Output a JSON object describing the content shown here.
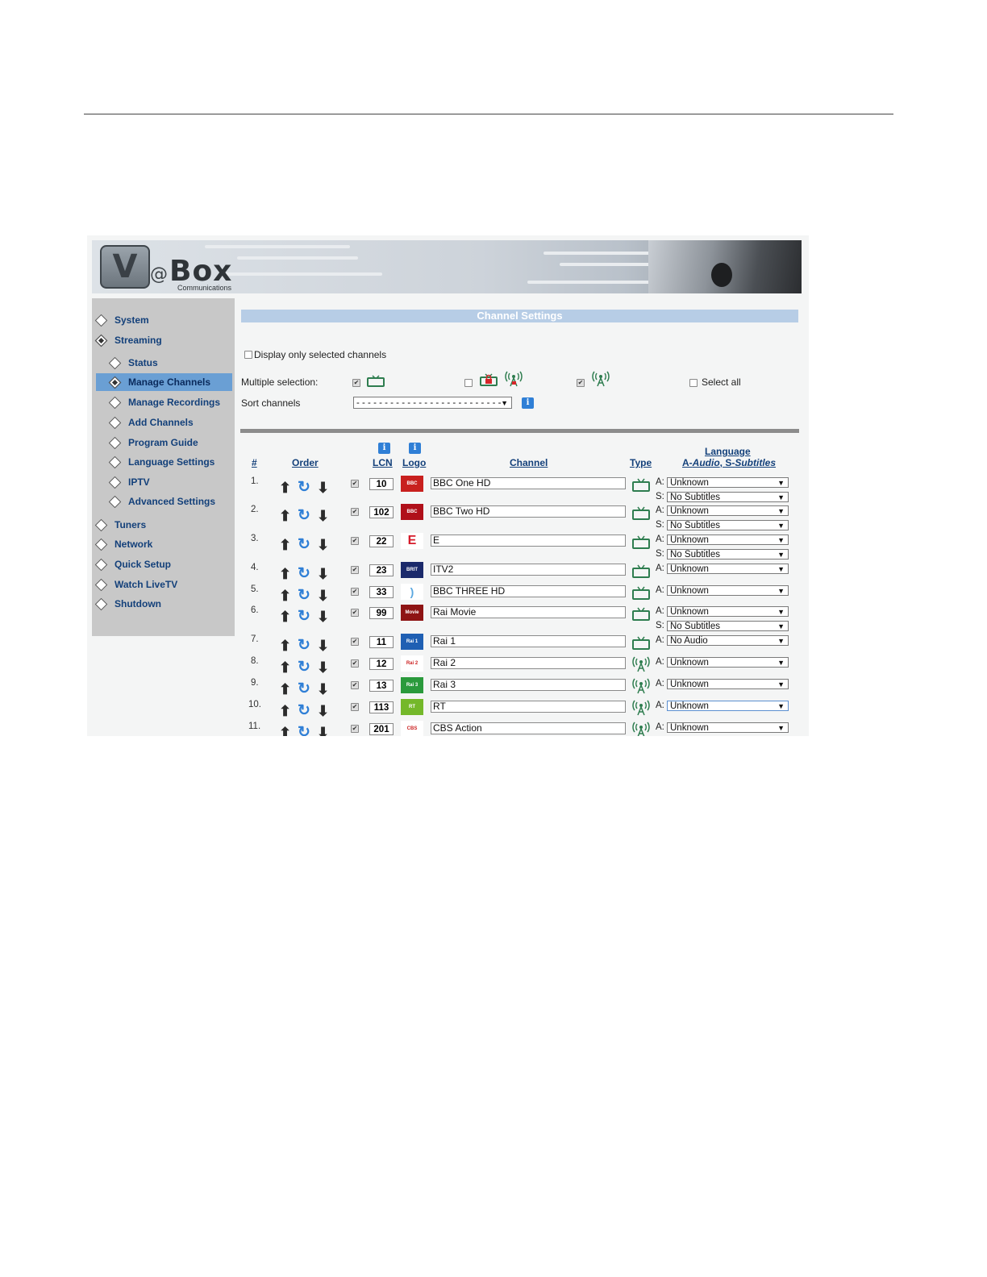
{
  "banner": {
    "logo_letter": "V",
    "logo_at": "@",
    "logo_text": "Box",
    "logo_sub": "Communications"
  },
  "sidebar": {
    "items": [
      {
        "label": "System",
        "indent": false,
        "filled": false,
        "active": false
      },
      {
        "label": "Streaming",
        "indent": false,
        "filled": true,
        "active": false
      },
      {
        "label": "Status",
        "indent": true,
        "filled": false,
        "active": false
      },
      {
        "label": "Manage Channels",
        "indent": true,
        "filled": true,
        "active": true
      },
      {
        "label": "Manage Recordings",
        "indent": true,
        "filled": false,
        "active": false
      },
      {
        "label": "Add Channels",
        "indent": true,
        "filled": false,
        "active": false
      },
      {
        "label": "Program Guide",
        "indent": true,
        "filled": false,
        "active": false
      },
      {
        "label": "Language Settings",
        "indent": true,
        "filled": false,
        "active": false
      },
      {
        "label": "IPTV",
        "indent": true,
        "filled": false,
        "active": false
      },
      {
        "label": "Advanced Settings",
        "indent": true,
        "filled": false,
        "active": false
      },
      {
        "label": "Tuners",
        "indent": false,
        "filled": false,
        "active": false
      },
      {
        "label": "Network",
        "indent": false,
        "filled": false,
        "active": false
      },
      {
        "label": "Quick Setup",
        "indent": false,
        "filled": false,
        "active": false
      },
      {
        "label": "Watch LiveTV",
        "indent": false,
        "filled": false,
        "active": false
      },
      {
        "label": "Shutdown",
        "indent": false,
        "filled": false,
        "active": false
      }
    ]
  },
  "main": {
    "title": "Channel Settings",
    "display_only_label": "Display only selected channels",
    "display_only_checked": false,
    "multiple_selection_label": "Multiple selection:",
    "multi_tv_checked": true,
    "multi_locked_checked": false,
    "multi_radio_checked": true,
    "select_all_label": "Select all",
    "select_all_checked": false,
    "sort_label": "Sort channels",
    "sort_value": "- - - - - - - - - - - - - - - - - - - - - - - - - -",
    "info_glyph": "i"
  },
  "table": {
    "headers": {
      "num": "#",
      "order": "Order",
      "lcn": "LCN",
      "logo": "Logo",
      "channel": "Channel",
      "type": "Type",
      "language_line1": "Language",
      "language_line2_a": "A-",
      "language_line2_b": "Audio",
      "language_line2_c": ", S-",
      "language_line2_d": "Subtitles"
    },
    "audio_prefix": "A:",
    "sub_prefix": "S:",
    "rows": [
      {
        "num": "1.",
        "lcn": "10",
        "name": "BBC One HD",
        "type": "tv",
        "logo": "BBC NEWS",
        "logo_bg": "#c8201e",
        "audio": "Unknown",
        "subtitles": "No Subtitles"
      },
      {
        "num": "2.",
        "lcn": "102",
        "name": "BBC Two HD",
        "type": "tv",
        "logo": "BBC NEWS",
        "logo_bg": "#b0101a",
        "audio": "Unknown",
        "subtitles": "No Subtitles"
      },
      {
        "num": "3.",
        "lcn": "22",
        "name": "E",
        "type": "tv",
        "logo": "E",
        "logo_bg": "#ffffff",
        "audio": "Unknown",
        "subtitles": "No Subtitles"
      },
      {
        "num": "4.",
        "lcn": "23",
        "name": "ITV2",
        "type": "tv",
        "logo": "BRIT",
        "logo_bg": "#1b2a6b",
        "audio": "Unknown",
        "subtitles": null
      },
      {
        "num": "5.",
        "lcn": "33",
        "name": "BBC THREE HD",
        "type": "tv",
        "logo": ")",
        "logo_bg": "#ffffff",
        "audio": "Unknown",
        "subtitles": null
      },
      {
        "num": "6.",
        "lcn": "99",
        "name": "Rai Movie",
        "type": "tv",
        "logo": "Movie",
        "logo_bg": "#8e1414",
        "audio": "Unknown",
        "subtitles": "No Subtitles"
      },
      {
        "num": "7.",
        "lcn": "11",
        "name": "Rai 1",
        "type": "tv",
        "logo": "Rai 1",
        "logo_bg": "#1f5fb3",
        "audio": "No Audio",
        "subtitles": null
      },
      {
        "num": "8.",
        "lcn": "12",
        "name": "Rai 2",
        "type": "radio",
        "logo": "Rai 2",
        "logo_bg": "#ffffff",
        "audio": "Unknown",
        "subtitles": null
      },
      {
        "num": "9.",
        "lcn": "13",
        "name": "Rai 3",
        "type": "radio",
        "logo": "Rai 3",
        "logo_bg": "#2a9a3c",
        "audio": "Unknown",
        "subtitles": null
      },
      {
        "num": "10.",
        "lcn": "113",
        "name": "RT",
        "type": "radio",
        "logo": "RT",
        "logo_bg": "#74b82a",
        "audio": "Unknown",
        "subtitles": null,
        "focused": true
      },
      {
        "num": "11.",
        "lcn": "201",
        "name": "CBS Action",
        "type": "radio",
        "logo": "CBS action",
        "logo_bg": "#ffffff",
        "audio": "Unknown",
        "subtitles": null
      }
    ]
  },
  "colors": {
    "nav_text": "#13407a",
    "active_nav": "#6a9fd4",
    "title_bar": "#b7cde6",
    "icon_green": "#2e7d4f",
    "info_blue": "#2f7fd6"
  },
  "icons": {
    "up": "⬆",
    "down": "⬇",
    "refresh": "↻",
    "check": "✔",
    "dropdown": "▼"
  }
}
